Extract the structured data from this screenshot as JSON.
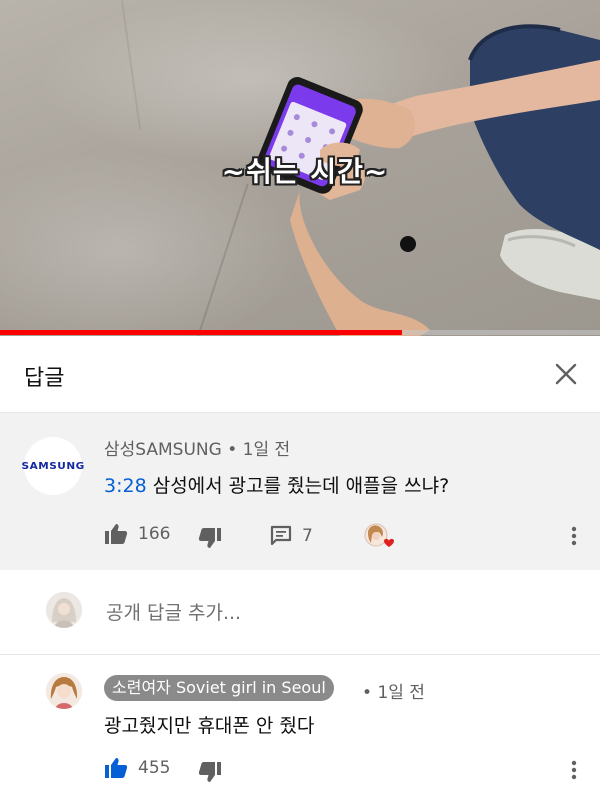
{
  "video": {
    "subtitle": "~쉬는 시간~",
    "progress_fraction": 0.67
  },
  "panel": {
    "title": "답글",
    "close_icon": "close-icon"
  },
  "parent_comment": {
    "author": "삼성SAMSUNG",
    "separator": " • ",
    "time": "1일 전",
    "avatar_text": "SAMSUNG",
    "timestamp_link": "3:28",
    "text": " 삼성에서 광고를 줬는데 애플을 쓰냐?",
    "likes": "166",
    "replies": "7",
    "icons": [
      "thumb-up-icon",
      "thumb-down-icon",
      "comment-icon",
      "creator-heart-icon",
      "more-vert-icon"
    ]
  },
  "add_reply": {
    "placeholder": "공개 답글 추가..."
  },
  "reply_comment": {
    "author": "소련여자 Soviet girl in Seoul",
    "separator": " • ",
    "time": "1일 전",
    "text": "광고줬지만 휴대폰 안 줬다",
    "likes": "455",
    "icons": [
      "thumb-up-filled-icon",
      "thumb-down-icon",
      "more-vert-icon"
    ]
  },
  "colors": {
    "progress": "#ff0000",
    "link": "#065fd4",
    "liked": "#065fd4",
    "samsung_blue": "#1428a0"
  }
}
